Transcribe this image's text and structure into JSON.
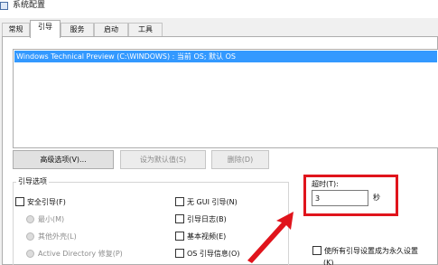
{
  "window": {
    "title": "系统配置"
  },
  "tabs": [
    {
      "label": "常规",
      "active": false
    },
    {
      "label": "引导",
      "active": true
    },
    {
      "label": "服务",
      "active": false
    },
    {
      "label": "启动",
      "active": false
    },
    {
      "label": "工具",
      "active": false
    }
  ],
  "boot_list": {
    "items": [
      {
        "label": "Windows Technical Preview (C:\\WINDOWS) : 当前 OS; 默认 OS",
        "selected": true
      }
    ]
  },
  "buttons": {
    "advanced": "高级选项(V)...",
    "set_default": "设为默认值(S)",
    "delete": "删除(D)"
  },
  "boot_options": {
    "group_label": "引导选项",
    "safe_boot": "安全引导(F)",
    "minimal": "最小(M)",
    "alternate_shell": "其他外壳(L)",
    "active_directory_repair": "Active Directory 修复(P)",
    "no_gui_boot": "无 GUI 引导(N)",
    "boot_log": "引导日志(B)",
    "base_video": "基本视频(E)",
    "os_boot_info": "OS 引导信息(O)"
  },
  "timeout": {
    "label": "超时(T):",
    "value": "3",
    "unit": "秒"
  },
  "make_permanent": {
    "label": "使所有引导设置成为永久设置",
    "shortcut": "(K)"
  },
  "colors": {
    "highlight": "#e0141c",
    "selection": "#3399ff"
  }
}
